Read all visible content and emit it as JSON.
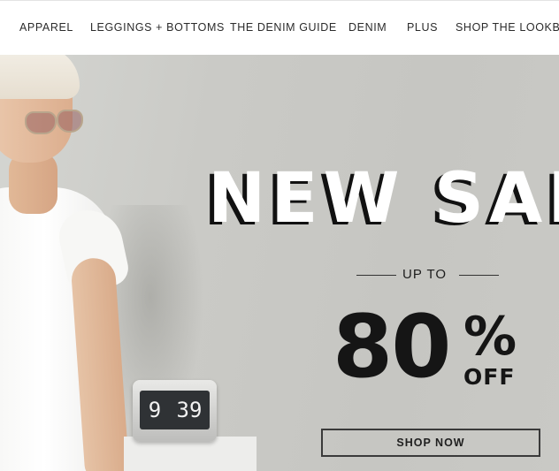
{
  "nav": {
    "items": [
      {
        "label": "APPAREL"
      },
      {
        "label": "LEGGINGS + BOTTOMS"
      },
      {
        "label": "THE DENIM GUIDE"
      },
      {
        "label": "DENIM"
      },
      {
        "label": "PLUS"
      },
      {
        "label": "SHOP THE LOOKBO"
      }
    ]
  },
  "hero": {
    "headline": "NEW SAL",
    "subheadline": "UP TO",
    "discount_number": "80",
    "discount_symbol": "%",
    "discount_suffix": "OFF",
    "cta_label": "SHOP NOW",
    "clock_hour": "9",
    "clock_minutes": "39"
  },
  "colors": {
    "background": "#c9c9c5",
    "text_dark": "#151515",
    "nav_text": "#2b2b2b"
  }
}
